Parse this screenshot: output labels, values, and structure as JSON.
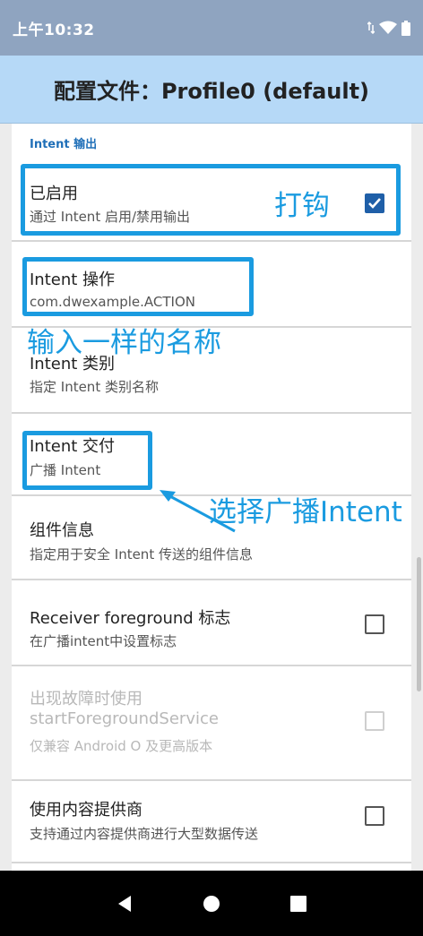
{
  "status_bar": {
    "time": "上午10:32",
    "icons": [
      "data-transfer-icon",
      "wifi-icon",
      "battery-icon"
    ]
  },
  "app_bar": {
    "title": "配置文件：Profile0 (default)"
  },
  "section": {
    "header": "Intent 输出"
  },
  "settings": [
    {
      "title": "已启用",
      "subtitle": "通过 Intent 启用/禁用输出",
      "checkbox": "checked"
    },
    {
      "title": "Intent 操作",
      "subtitle": "com.dwexample.ACTION"
    },
    {
      "title": "Intent 类别",
      "subtitle": "指定 Intent 类别名称"
    },
    {
      "title": "Intent 交付",
      "subtitle": "广播 Intent"
    },
    {
      "title": "组件信息",
      "subtitle": "指定用于安全 Intent 传送的组件信息"
    },
    {
      "title": "Receiver foreground 标志",
      "subtitle": "在广播intent中设置标志",
      "checkbox": "unchecked"
    },
    {
      "title": "出现故障时使用",
      "title2": "startForegroundService",
      "subtitle": "仅兼容 Android O 及更高版本",
      "checkbox": "disabled"
    },
    {
      "title": "使用内容提供商",
      "subtitle": "支持通过内容提供商进行大型数据传送",
      "checkbox": "unchecked"
    }
  ],
  "annotations": {
    "check_note": "打钩",
    "name_note": "输入一样的名称",
    "broadcast_note": "选择广播Intent"
  },
  "colors": {
    "status_bar": "#8fa4c0",
    "app_bar": "#b6d9f7",
    "accent": "#1f6fb8",
    "annotation": "#1a9be0",
    "checkbox_checked": "#1f5fa8"
  },
  "nav_bar": {
    "buttons": [
      "back-icon",
      "home-icon",
      "recents-icon"
    ]
  }
}
